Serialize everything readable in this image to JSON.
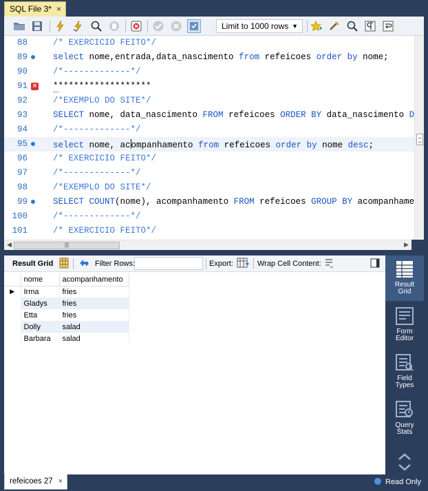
{
  "tab": {
    "title": "SQL File 3*",
    "close": "×"
  },
  "toolbar": {
    "icons": [
      "open-folder-icon",
      "save-icon",
      "execute-icon",
      "execute-current-icon",
      "explain-icon",
      "stop-icon",
      "toggle-error-icon",
      "commit-icon",
      "rollback-icon",
      "autocommit-icon",
      "bookmark-icon",
      "beautify-icon",
      "find-icon",
      "invisible-chars-icon",
      "wrap-icon"
    ],
    "limit_label": "Limit to 1000 rows"
  },
  "editor": {
    "lines": [
      {
        "num": "88",
        "mark": "",
        "html": "<span class=\"cm\">/* EXERCICIO FEITO*/</span>"
      },
      {
        "num": "89",
        "mark": "dot",
        "html": "<span class=\"kw\">select</span> nome,entrada,data_nascimento <span class=\"kw\">from</span> refeicoes <span class=\"kw\">order by</span> nome;"
      },
      {
        "num": "90",
        "mark": "",
        "html": "<span class=\"cm\">/*-------------*/</span>"
      },
      {
        "num": "91",
        "mark": "err",
        "html": "*******************"
      },
      {
        "num": "92",
        "mark": "",
        "html": "<span class=\"cm\">/*EXEMPLO DO SITE*/</span>"
      },
      {
        "num": "93",
        "mark": "",
        "html": "<span class=\"kw\">SELECT</span> nome, data_nascimento <span class=\"kw\">FROM</span> refeicoes <span class=\"kw\">ORDER BY</span> data_nascimento <span class=\"kw\">DESC</span>;"
      },
      {
        "num": "94",
        "mark": "",
        "html": "<span class=\"cm\">/*-------------*/</span>"
      },
      {
        "num": "95",
        "mark": "dot",
        "html": "<span class=\"kw\">select</span> nome, ac<span class=\"caretbar\"></span>ompanhamento <span class=\"kw\">from</span> refeicoes <span class=\"kw\">order by</span> nome <span class=\"kw\">desc</span>;",
        "current": true
      },
      {
        "num": "96",
        "mark": "",
        "html": "<span class=\"cm\">/* EXERCICIO FEITO*/</span>"
      },
      {
        "num": "97",
        "mark": "",
        "html": "<span class=\"cm\">/*-------------*/</span>"
      },
      {
        "num": "98",
        "mark": "",
        "html": "<span class=\"cm\">/*EXEMPLO DO SITE*/</span>"
      },
      {
        "num": "99",
        "mark": "dot",
        "html": "<span class=\"kw\">SELECT</span> <span class=\"kw\">COUNT</span>(nome), acompanhamento <span class=\"kw\">FROM</span> refeicoes <span class=\"kw\">GROUP BY</span> acompanhamento <span class=\"kw\">H</span>"
      },
      {
        "num": "100",
        "mark": "",
        "html": "<span class=\"cm\">/*-------------*/</span>"
      },
      {
        "num": "101",
        "mark": "",
        "html": "<span class=\"cm\">/* EXERCICIO FEITO*/</span>"
      }
    ]
  },
  "result_toolbar": {
    "result_grid": "Result Grid",
    "filter_rows": "Filter Rows:",
    "filter_value": "",
    "export": "Export:",
    "wrap": "Wrap Cell Content:"
  },
  "grid": {
    "columns": [
      "nome",
      "acompanhamento"
    ],
    "rows": [
      [
        "Irma",
        "fries"
      ],
      [
        "Gladys",
        "fries"
      ],
      [
        "Etta",
        "fries"
      ],
      [
        "Dolly",
        "salad"
      ],
      [
        "Barbara",
        "salad"
      ]
    ]
  },
  "side_panel": [
    {
      "name": "result-grid-button",
      "label1": "Result",
      "label2": "Grid",
      "active": true
    },
    {
      "name": "form-editor-button",
      "label1": "Form",
      "label2": "Editor",
      "active": false
    },
    {
      "name": "field-types-button",
      "label1": "Field",
      "label2": "Types",
      "active": false
    },
    {
      "name": "query-stats-button",
      "label1": "Query",
      "label2": "Stats",
      "active": false
    }
  ],
  "bottom": {
    "result_tab": "refeicoes 27",
    "close": "×",
    "status": "Read Only"
  },
  "colors": {
    "keyword": "#1a55c7",
    "comment": "#3c7ad8",
    "chrome": "#2b3e5c",
    "tab": "#f5e9a6"
  }
}
